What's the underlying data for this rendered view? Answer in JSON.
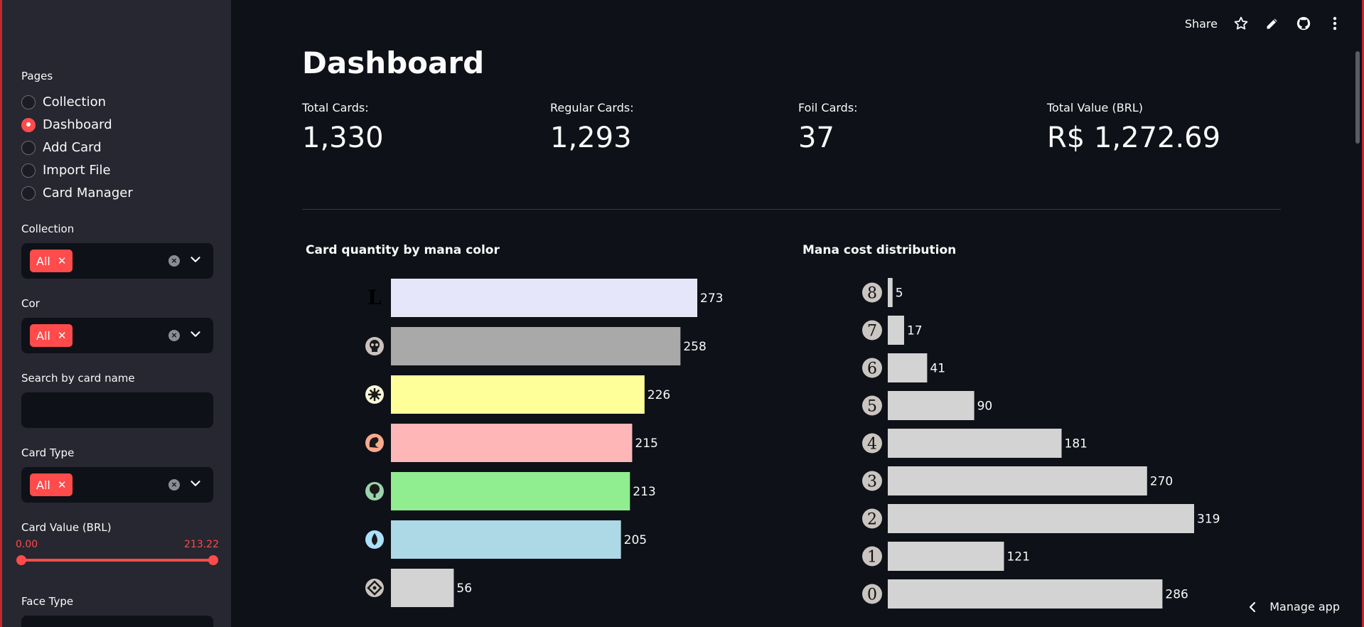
{
  "sidebar": {
    "pages_label": "Pages",
    "pages": [
      {
        "label": "Collection",
        "selected": false
      },
      {
        "label": "Dashboard",
        "selected": true
      },
      {
        "label": "Add Card",
        "selected": false
      },
      {
        "label": "Import File",
        "selected": false
      },
      {
        "label": "Card Manager",
        "selected": false
      }
    ],
    "collection_label": "Collection",
    "collection_chip": "All",
    "cor_label": "Cor",
    "cor_chip": "All",
    "search_label": "Search by card name",
    "search_value": "",
    "card_type_label": "Card Type",
    "card_type_chip": "All",
    "card_value_label": "Card Value (BRL)",
    "card_value_min": "0.00",
    "card_value_max": "213.22",
    "face_type_label": "Face Type"
  },
  "toolbar": {
    "share_label": "Share",
    "icons": [
      "star-icon",
      "edit-icon",
      "github-icon",
      "more-icon"
    ]
  },
  "main": {
    "title": "Dashboard",
    "metrics": [
      {
        "label": "Total Cards:",
        "value": "1,330"
      },
      {
        "label": "Regular Cards:",
        "value": "1,293"
      },
      {
        "label": "Foil Cards:",
        "value": "37"
      },
      {
        "label": "Total Value (BRL)",
        "value": "R$ 1,272.69"
      }
    ]
  },
  "manage_app_label": "Manage app",
  "colors": {
    "accent": "#ff4b4b",
    "sidebar_bg": "#262730",
    "main_bg": "#0e1117"
  },
  "chart_data": [
    {
      "type": "bar",
      "orientation": "horizontal",
      "title": "Card quantity by mana color",
      "categories": [
        "L",
        "black-mana-icon",
        "white-mana-icon",
        "red-mana-icon",
        "green-mana-icon",
        "blue-mana-icon",
        "colorless-mana-icon"
      ],
      "values": [
        273,
        258,
        226,
        215,
        213,
        205,
        56
      ],
      "bar_colors": [
        "#e6e6fa",
        "#a9a9a9",
        "#ffff99",
        "#ffb6b6",
        "#90ee90",
        "#add8e6",
        "#d3d3d3"
      ],
      "xlim": [
        0,
        273
      ]
    },
    {
      "type": "bar",
      "orientation": "horizontal",
      "title": "Mana cost distribution",
      "categories": [
        "8",
        "7",
        "6",
        "5",
        "4",
        "3",
        "2",
        "1",
        "0"
      ],
      "values": [
        5,
        17,
        41,
        90,
        181,
        270,
        319,
        121,
        286
      ],
      "bar_color": "#d3d3d3",
      "xlim": [
        0,
        319
      ]
    }
  ]
}
